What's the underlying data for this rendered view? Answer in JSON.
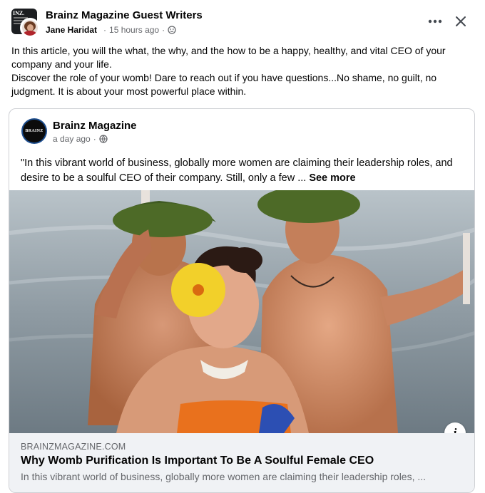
{
  "header": {
    "group_name": "Brainz Magazine Guest Writers",
    "author": "Jane Haridat",
    "time": "15 hours ago",
    "audience_icon": "group-audience-icon",
    "avatar_text": "INZ."
  },
  "post": {
    "paragraph_1": "In this article, you will the what, the why, and the how to be a happy, healthy, and vital CEO of your company and your life.",
    "paragraph_2": "Discover the role of your womb! Dare to reach out if you have questions...No shame, no guilt, no judgment. It is about your most powerful place within."
  },
  "shared": {
    "page_name": "Brainz Magazine",
    "page_avatar_text": "BRAINZ",
    "time": "a day ago",
    "audience_icon": "globe-icon",
    "text": "\"In this vibrant world of business, globally more women are claiming their leadership roles, and desire to be a soulful CEO of their company. Still, only a few ...",
    "see_more": "See more"
  },
  "link": {
    "domain": "BRAINZMAGAZINE.COM",
    "title": "Why Womb Purification Is Important To Be A Soulful Female CEO",
    "description": "In this vibrant world of business, globally more women are claiming their leadership roles, ..."
  },
  "icons": {
    "more": "more-options-icon",
    "close": "close-icon",
    "info": "info-icon"
  },
  "colors": {
    "text_primary": "#050505",
    "text_secondary": "#65676b",
    "preview_bg": "#f0f2f5"
  }
}
